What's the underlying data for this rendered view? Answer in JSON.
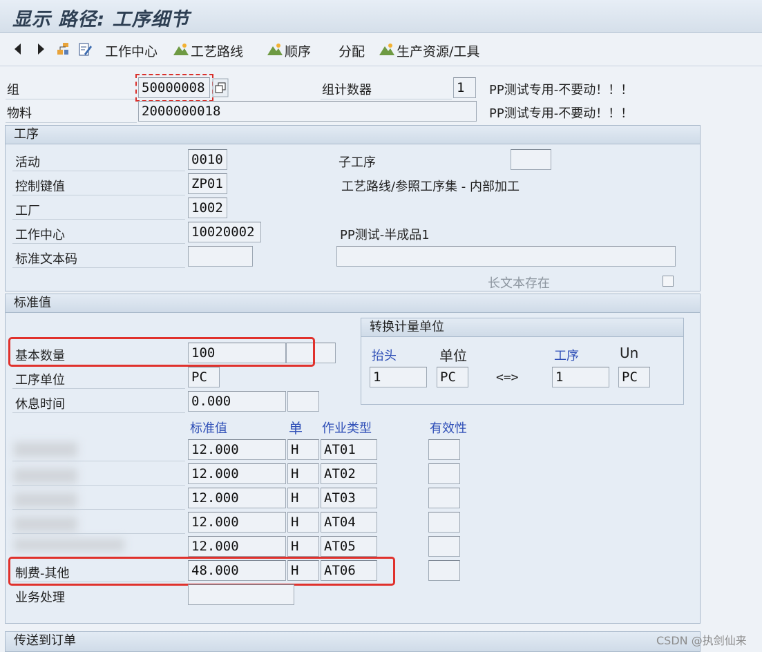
{
  "title": "显示 路径: 工序细节",
  "toolbar": {
    "items": [
      "工作中心",
      "工艺路线",
      "顺序",
      "分配",
      "生产资源/工具"
    ]
  },
  "header": {
    "group_label": "组",
    "group_value": "50000008",
    "group_counter_label": "组计数器",
    "group_counter_value": "1",
    "group_desc": "PP测试专用-不要动！！！",
    "material_label": "物料",
    "material_value": "2000000018",
    "material_desc": "PP测试专用-不要动！！！"
  },
  "operation": {
    "section_title": "工序",
    "activity_label": "活动",
    "activity_value": "0010",
    "sub_op_label": "子工序",
    "sub_op_value": "",
    "control_key_label": "控制键值",
    "control_key_value": "ZP01",
    "control_key_desc": "工艺路线/参照工序集 - 内部加工",
    "plant_label": "工厂",
    "plant_value": "1002",
    "work_center_label": "工作中心",
    "work_center_value": "10020002",
    "work_center_desc": "PP测试-半成品1",
    "std_text_label": "标准文本码",
    "std_text_value": "",
    "long_text_label": "长文本存在"
  },
  "standard": {
    "section_title": "标准值",
    "base_qty_label": "基本数量",
    "base_qty_value": "100",
    "op_unit_label": "工序单位",
    "op_unit_value": "PC",
    "break_label": "休息时间",
    "break_value": "0.000",
    "col_std": "标准值",
    "col_unit": "单",
    "col_activity": "作业类型",
    "col_valid": "有效性",
    "rows": [
      {
        "label": "",
        "value": "12.000",
        "unit": "H",
        "activity": "AT01"
      },
      {
        "label": "",
        "value": "12.000",
        "unit": "H",
        "activity": "AT02"
      },
      {
        "label": "",
        "value": "12.000",
        "unit": "H",
        "activity": "AT03"
      },
      {
        "label": "",
        "value": "12.000",
        "unit": "H",
        "activity": "AT04"
      },
      {
        "label": "",
        "value": "12.000",
        "unit": "H",
        "activity": "AT05"
      },
      {
        "label": "制费-其他",
        "value": "48.000",
        "unit": "H",
        "activity": "AT06"
      }
    ],
    "business_label": "业务处理",
    "conversion": {
      "title": "转换计量单位",
      "header_label": "抬头",
      "unit_label": "单位",
      "op_label": "工序",
      "un_label": "Un",
      "header_value": "1",
      "header_unit": "PC",
      "arrow": "<=>",
      "op_value": "1",
      "op_unit": "PC"
    }
  },
  "transfer": {
    "section_title": "传送到订单"
  },
  "watermark": "CSDN @执剑仙来"
}
